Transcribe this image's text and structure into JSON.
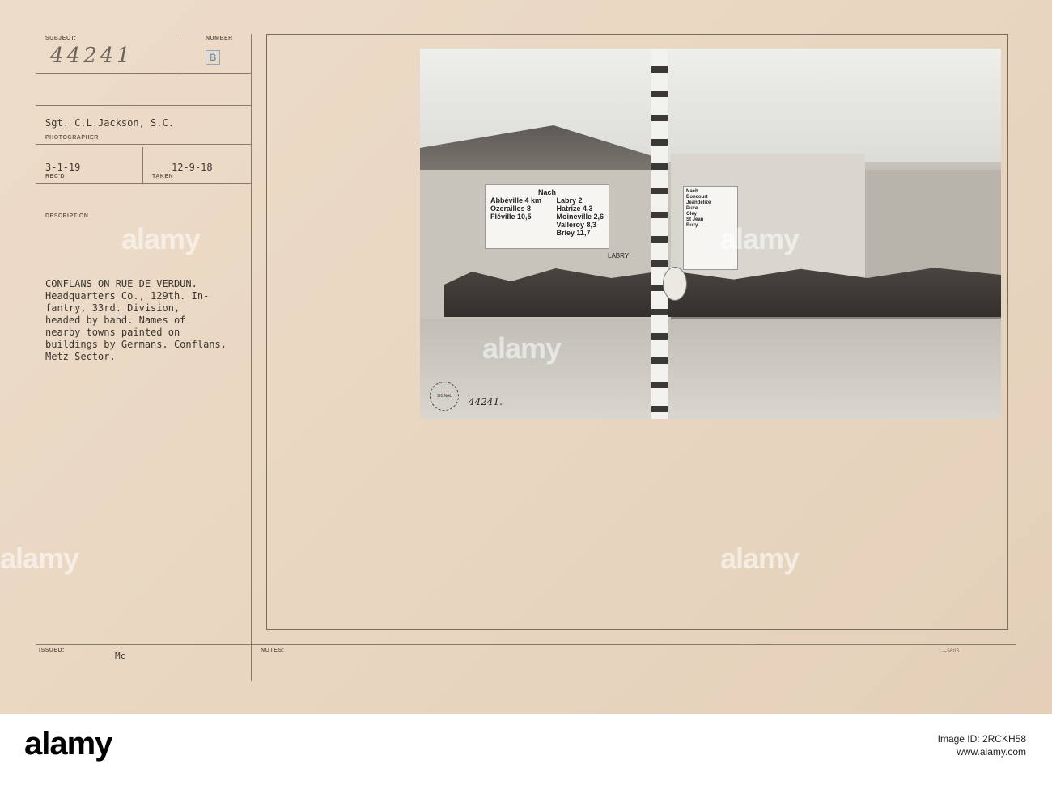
{
  "card": {
    "subject_label": "SUBJECT:",
    "subject_value": "44241",
    "number_label": "NUMBER",
    "number_stamp": "B",
    "photographer_value": "Sgt. C.L.Jackson, S.C.",
    "photographer_label": "PHOTOGRAPHER",
    "recd_value": "3-1-19",
    "recd_label": "REC'D",
    "taken_value": "12-9-18",
    "taken_label": "TAKEN",
    "description_label": "DESCRIPTION",
    "description_text": "CONFLANS ON RUE DE VERDUN.\nHeadquarters Co., 129th. In-\nfantry, 33rd. Division,\nheaded by band. Names of\nnearby towns painted on\nbuildings by Germans. Conflans,\nMetz Sector.",
    "issued_label": "ISSUED:",
    "issued_value": "Mc",
    "notes_label": "NOTES:",
    "form_number": "1—5605"
  },
  "photo": {
    "sign_left_title": "Nach",
    "sign_left_towns_a": "Abbéville 4 km\nOzerailles 8\nFléville 10,5",
    "sign_left_towns_b": "Labry 2\nHatrize 4,3\nMoineville 2,6\nValleroy 8,3\nBriey 11,7",
    "sign_right_text": "Nach\nBoncourt\nJeandelize\nPuxe\nOley\nSt Jean\nBuzy",
    "shop_sign": "LABRY",
    "corps_stamp": "SIGNAL CORPS USA",
    "photo_number": "44241."
  },
  "watermarks": [
    "alamy",
    "alamy",
    "alamy",
    "alamy",
    "alamy"
  ],
  "banner": {
    "logo": "alamy",
    "image_id": "Image ID: 2RCKH58",
    "site": "www.alamy.com"
  }
}
